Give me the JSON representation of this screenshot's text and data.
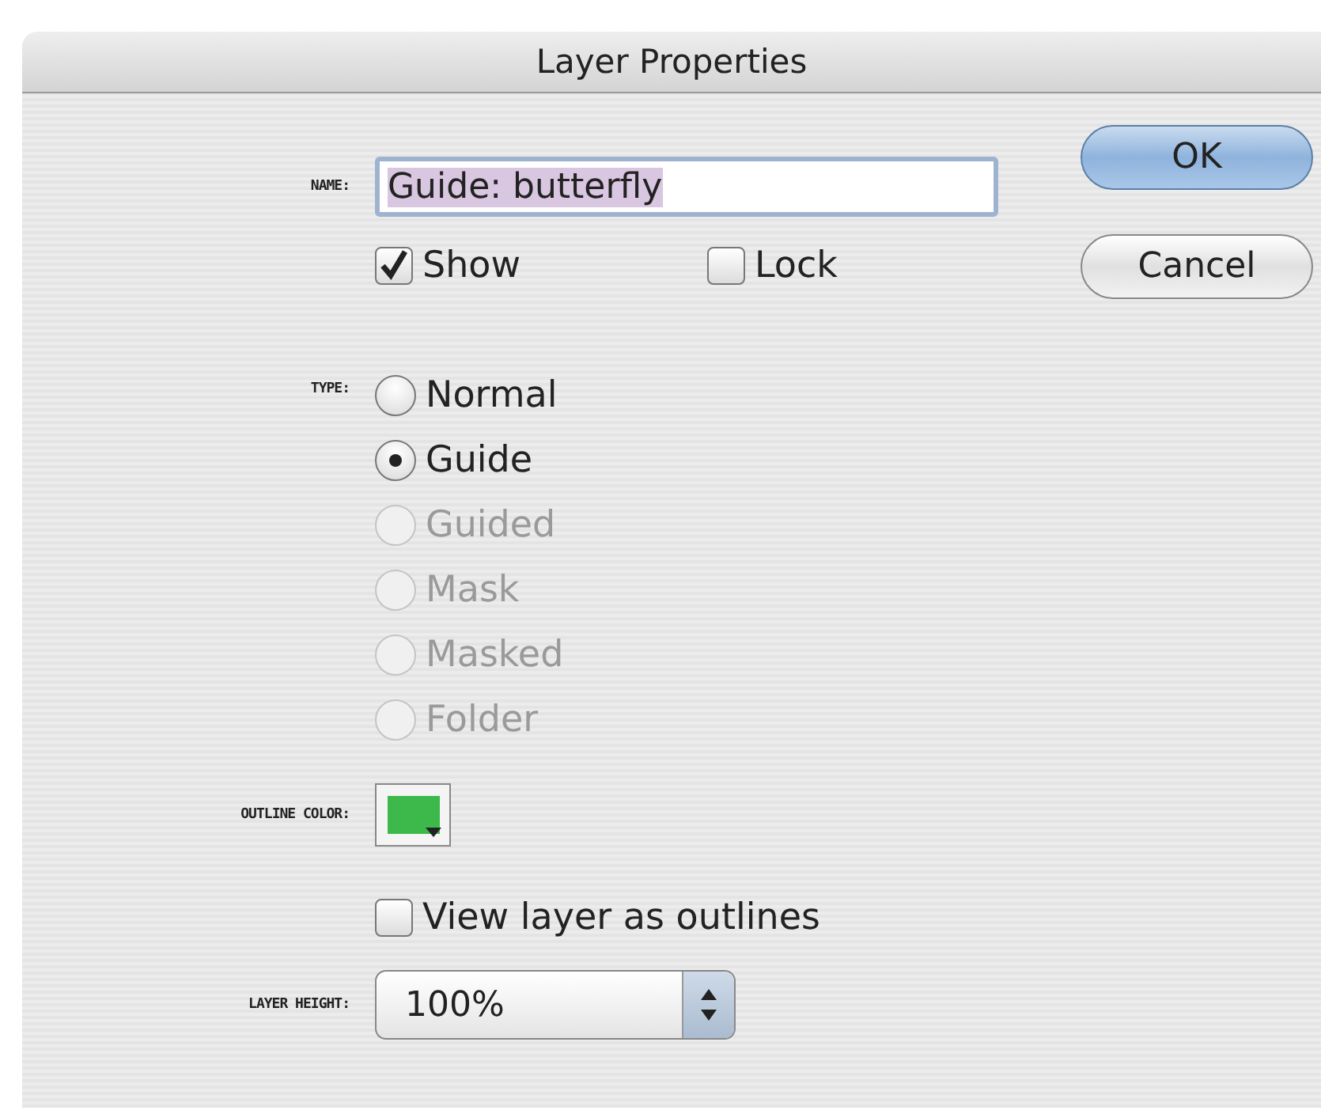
{
  "window": {
    "title": "Layer Properties"
  },
  "name": {
    "label": "NAME:",
    "value": "Guide: butterfly",
    "selected": true
  },
  "show": {
    "label": "Show",
    "checked": true
  },
  "lock": {
    "label": "Lock",
    "checked": false
  },
  "type": {
    "label": "TYPE:",
    "options": [
      {
        "label": "Normal",
        "selected": false,
        "disabled": false
      },
      {
        "label": "Guide",
        "selected": true,
        "disabled": false
      },
      {
        "label": "Guided",
        "selected": false,
        "disabled": true
      },
      {
        "label": "Mask",
        "selected": false,
        "disabled": true
      },
      {
        "label": "Masked",
        "selected": false,
        "disabled": true
      },
      {
        "label": "Folder",
        "selected": false,
        "disabled": true
      }
    ]
  },
  "outline_color": {
    "label": "OUTLINE COLOR:",
    "color": "#3cb94a"
  },
  "view_as_outlines": {
    "label": "View layer as outlines",
    "checked": false
  },
  "layer_height": {
    "label": "LAYER HEIGHT:",
    "value": "100%"
  },
  "buttons": [
    {
      "label": "OK",
      "default": true
    },
    {
      "label": "Cancel",
      "default": false
    }
  ]
}
